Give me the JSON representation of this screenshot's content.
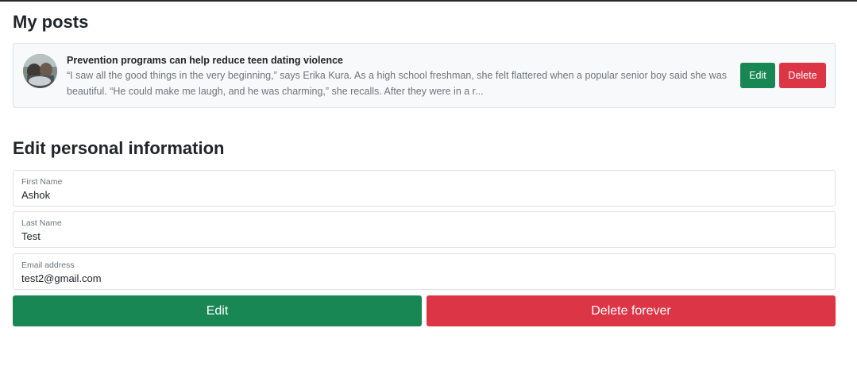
{
  "posts_section": {
    "heading": "My posts"
  },
  "posts": [
    {
      "title": "Prevention programs can help reduce teen dating violence",
      "excerpt": "“I saw all the good things in the very beginning,” says Erika Kura. As a high school freshman, she felt flattered when a popular senior boy said she was beautiful. “He could make me laugh, and he was charming,” she recalls. After they were in a r...",
      "edit_label": "Edit",
      "delete_label": "Delete"
    }
  ],
  "edit_section": {
    "heading": "Edit personal information"
  },
  "form": {
    "first_name": {
      "label": "First Name",
      "value": "Ashok"
    },
    "last_name": {
      "label": "Last Name",
      "value": "Test"
    },
    "email": {
      "label": "Email address",
      "value": "test2@gmail.com"
    }
  },
  "actions": {
    "edit_label": "Edit",
    "delete_label": "Delete forever"
  },
  "colors": {
    "success": "#198754",
    "danger": "#dc3545",
    "card_bg": "#f8f9fa",
    "border": "#dee2e6"
  }
}
